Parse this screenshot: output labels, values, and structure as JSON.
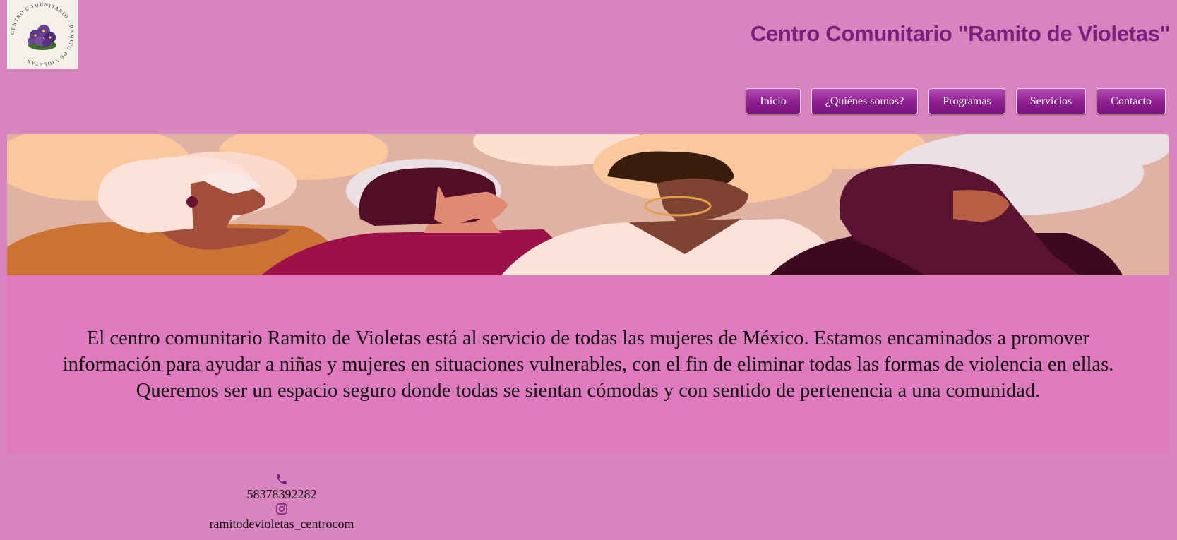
{
  "header": {
    "logo": {
      "ring_text": "CENTRO COMUNITARIO · RAMITO DE VIOLETAS ·",
      "flower_color": "#6a3f8f"
    },
    "title": "Centro Comunitario \"Ramito de Violetas\""
  },
  "nav": {
    "items": [
      {
        "label": "Inicio"
      },
      {
        "label": "¿Quiénes somos?"
      },
      {
        "label": "Programas"
      },
      {
        "label": "Servicios"
      },
      {
        "label": "Contacto"
      }
    ]
  },
  "hero": {
    "image": "banner-illustration-four-women-profiles"
  },
  "about": {
    "text": "El centro comunitario Ramito de Violetas está al servicio de todas las mujeres de México. Estamos encaminados a promover información para ayudar a niñas y mujeres en situaciones vulnerables, con el fin de eliminar todas las formas de violencia en ellas. Queremos ser un espacio seguro donde todas se sientan cómodas y con sentido de pertenencia a una comunidad."
  },
  "footer": {
    "phone_icon": "phone-icon",
    "phone": "58378392282",
    "instagram_icon": "instagram-icon",
    "instagram": "ramitodevioletas_centrocom"
  },
  "colors": {
    "page_bg": "#d884be",
    "title": "#7b1f7e",
    "button": "#8d1e8f",
    "about_bg": "#e07abf"
  }
}
